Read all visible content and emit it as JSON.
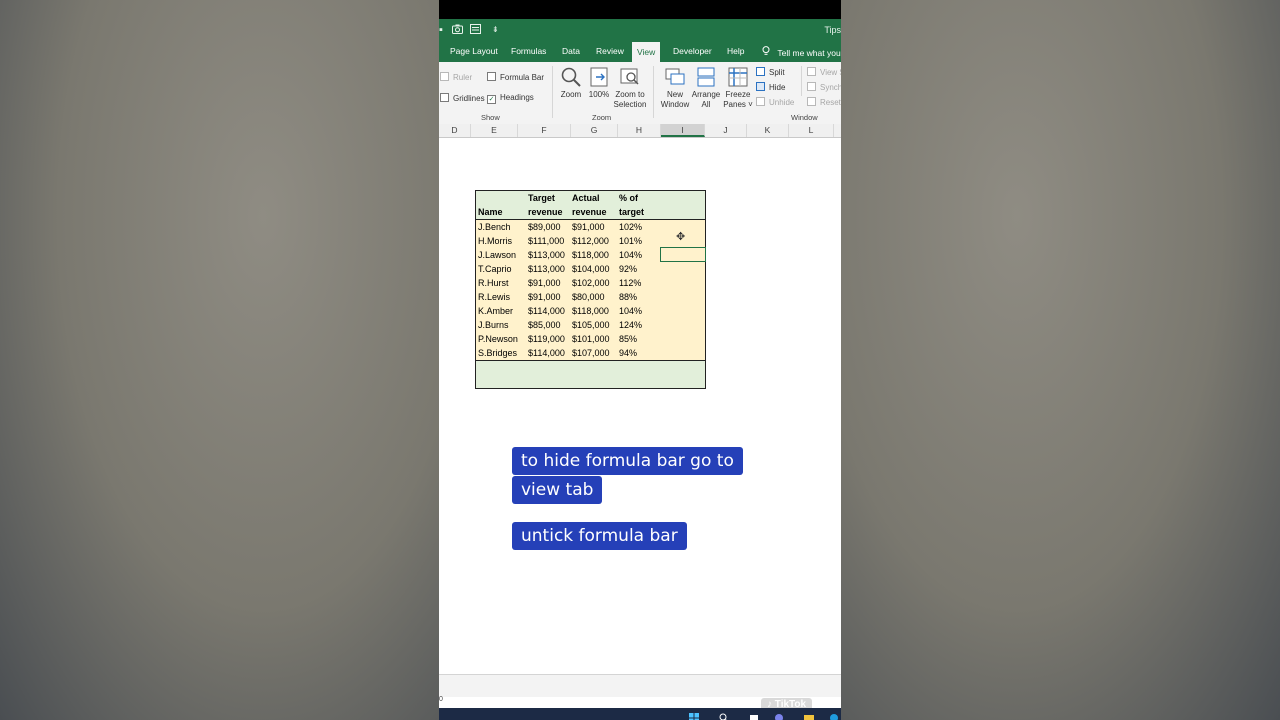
{
  "window": {
    "title": "Tips"
  },
  "ribbon_tabs": [
    "Page Layout",
    "Formulas",
    "Data",
    "Review",
    "View",
    "Developer",
    "Help"
  ],
  "active_tab": "View",
  "tell_me": "Tell me what you",
  "show_group": {
    "ruler": "Ruler",
    "formula_bar": "Formula Bar",
    "gridlines": "Gridlines",
    "headings": "Headings",
    "label": "Show"
  },
  "zoom_group": {
    "zoom": "Zoom",
    "zoom_100": "100%",
    "zoom_sel_1": "Zoom to",
    "zoom_sel_2": "Selection",
    "label": "Zoom"
  },
  "window_group": {
    "new_window_1": "New",
    "new_window_2": "Window",
    "arrange_1": "Arrange",
    "arrange_2": "All",
    "freeze_1": "Freeze",
    "freeze_2": "Panes",
    "split": "Split",
    "hide": "Hide",
    "unhide": "Unhide",
    "view_side": "View S",
    "synch": "Synch",
    "reset": "Reset",
    "label": "Window"
  },
  "columns": [
    "D",
    "E",
    "F",
    "G",
    "H",
    "I",
    "J",
    "K",
    "L"
  ],
  "selected_column": "I",
  "table": {
    "headers": {
      "name": "Name",
      "target_1": "Target",
      "target_2": "revenue",
      "actual_1": "Actual",
      "actual_2": "revenue",
      "pct_1": "% of",
      "pct_2": "target"
    },
    "rows": [
      [
        "J.Bench",
        "$89,000",
        "$91,000",
        "102%"
      ],
      [
        "H.Morris",
        "$111,000",
        "$112,000",
        "101%"
      ],
      [
        "J.Lawson",
        "$113,000",
        "$118,000",
        "104%"
      ],
      [
        "T.Caprio",
        "$113,000",
        "$104,000",
        "92%"
      ],
      [
        "R.Hurst",
        "$91,000",
        "$102,000",
        "112%"
      ],
      [
        "R.Lewis",
        "$91,000",
        "$80,000",
        "88%"
      ],
      [
        "K.Amber",
        "$114,000",
        "$118,000",
        "104%"
      ],
      [
        "J.Burns",
        "$85,000",
        "$105,000",
        "124%"
      ],
      [
        "P.Newson",
        "$119,000",
        "$101,000",
        "85%"
      ],
      [
        "S.Bridges",
        "$114,000",
        "$107,000",
        "94%"
      ]
    ]
  },
  "captions": {
    "line1": "to hide formula bar go to",
    "line2": "view tab",
    "line3": "untick formula bar"
  },
  "watermark": "TikTok",
  "status": {
    "zoom_fragment": "0"
  },
  "colors": {
    "excel_green": "#217346",
    "caption_bg": "#2540b8",
    "table_header": "#e2efda",
    "table_body": "#fff2cc"
  }
}
